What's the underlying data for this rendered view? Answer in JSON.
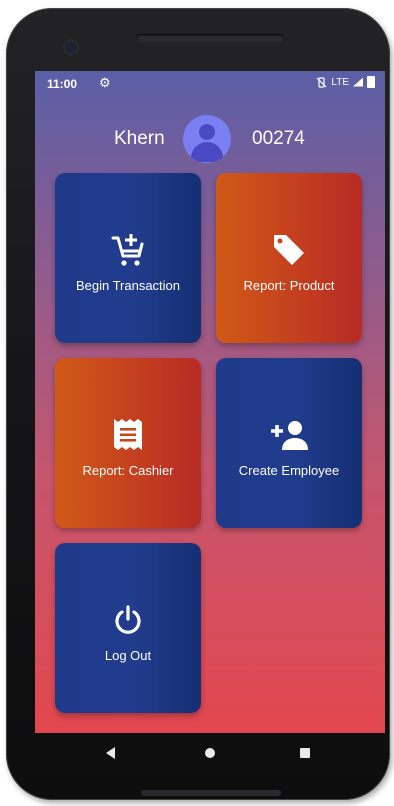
{
  "status_bar": {
    "time": "11:00",
    "network": "LTE",
    "icons": [
      "gear-icon",
      "vibrate-off-icon",
      "signal-icon",
      "battery-icon"
    ]
  },
  "header": {
    "user_name": "Khern",
    "user_id": "00274",
    "avatar_icon": "account-circle-icon"
  },
  "tiles": [
    {
      "label": "Begin Transaction",
      "icon": "add-to-cart-icon",
      "color": "#1f3a8a"
    },
    {
      "label": "Report: Product",
      "icon": "tag-icon",
      "color": "#c8461d"
    },
    {
      "label": "Report: Cashier",
      "icon": "receipt-icon",
      "color": "#c8461d"
    },
    {
      "label": "Create Employee",
      "icon": "add-person-icon",
      "color": "#1f3a8a"
    },
    {
      "label": "Log Out",
      "icon": "power-icon",
      "color": "#1f3a8a"
    }
  ],
  "nav_bar": {
    "buttons": [
      "back-icon",
      "home-icon",
      "recents-icon"
    ]
  }
}
